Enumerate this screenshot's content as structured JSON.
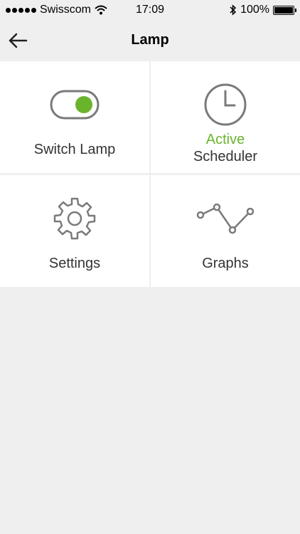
{
  "status_bar": {
    "carrier": "Swisscom",
    "time": "17:09",
    "battery": "100%"
  },
  "header": {
    "title": "Lamp"
  },
  "tiles": [
    {
      "label": "Switch Lamp",
      "icon": "toggle-switch-icon",
      "state": "on"
    },
    {
      "label": "Scheduler",
      "status": "Active",
      "icon": "clock-icon"
    },
    {
      "label": "Settings",
      "icon": "gear-icon"
    },
    {
      "label": "Graphs",
      "icon": "line-graph-icon"
    }
  ],
  "colors": {
    "accent": "#6ab42d",
    "icon_stroke": "#7a7a7a",
    "background": "#efefef",
    "tile": "#ffffff"
  }
}
